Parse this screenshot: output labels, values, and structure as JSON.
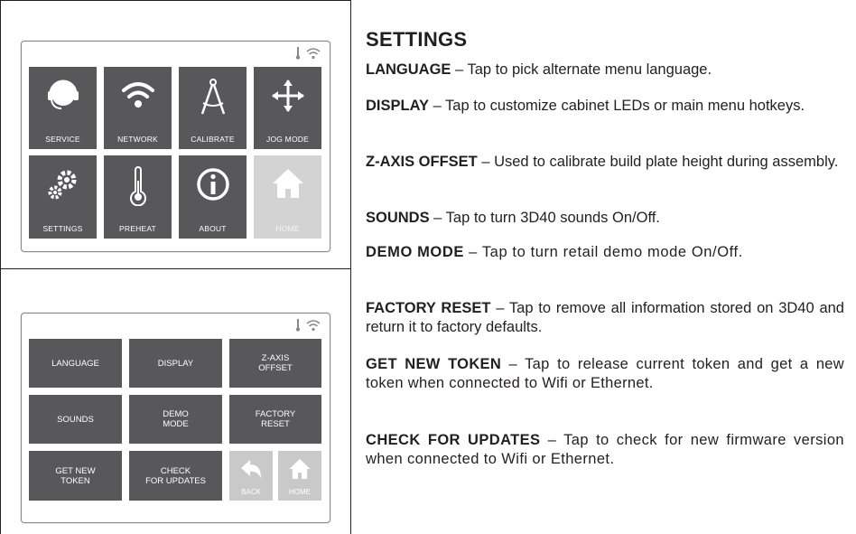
{
  "main_menu": {
    "tiles": [
      {
        "label": "SERVICE",
        "icon": "headset-icon"
      },
      {
        "label": "NETWORK",
        "icon": "wifi-icon"
      },
      {
        "label": "CALIBRATE",
        "icon": "compass-icon"
      },
      {
        "label": "JOG MODE",
        "icon": "move-arrows-icon"
      },
      {
        "label": "SETTINGS",
        "icon": "gears-icon"
      },
      {
        "label": "PREHEAT",
        "icon": "thermometer-icon"
      },
      {
        "label": "ABOUT",
        "icon": "info-icon"
      },
      {
        "label": "HOME",
        "icon": "home-icon",
        "disabled": true
      }
    ]
  },
  "settings_menu": {
    "buttons": [
      {
        "label": "LANGUAGE"
      },
      {
        "label": "DISPLAY"
      },
      {
        "label": "Z-AXIS\nOFFSET"
      },
      {
        "label": "SOUNDS"
      },
      {
        "label": "DEMO\nMODE"
      },
      {
        "label": "FACTORY\nRESET"
      },
      {
        "label": "GET NEW\nTOKEN"
      },
      {
        "label": "CHECK\nFOR UPDATES"
      }
    ],
    "back_label": "BACK",
    "home_label": "HOME"
  },
  "doc": {
    "title": "SETTINGS",
    "items": [
      {
        "term": "LANGUAGE",
        "text": " – Tap to pick alternate menu language."
      },
      {
        "term": "DISPLAY",
        "text": " – Tap to customize cabinet LEDs or main menu hotkeys."
      },
      {
        "term": "Z-AXIS OFFSET",
        "text": " – Used to calibrate build plate height during assembly."
      },
      {
        "term": "SOUNDS",
        "text": " – Tap to turn 3D40 sounds On/Off."
      },
      {
        "term": "DEMO MODE",
        "text": " – Tap to turn retail demo mode On/Off."
      },
      {
        "term": "FACTORY RESET",
        "text": " – Tap to remove all information stored on 3D40 and return it to factory defaults."
      },
      {
        "term": "GET NEW TOKEN",
        "text": " – Tap to release current token and get a new token when connected to Wifi or Ethernet."
      },
      {
        "term": "CHECK FOR UPDATES",
        "text": " – Tap to check for new firmware version when connected to Wifi or Ethernet."
      }
    ]
  }
}
